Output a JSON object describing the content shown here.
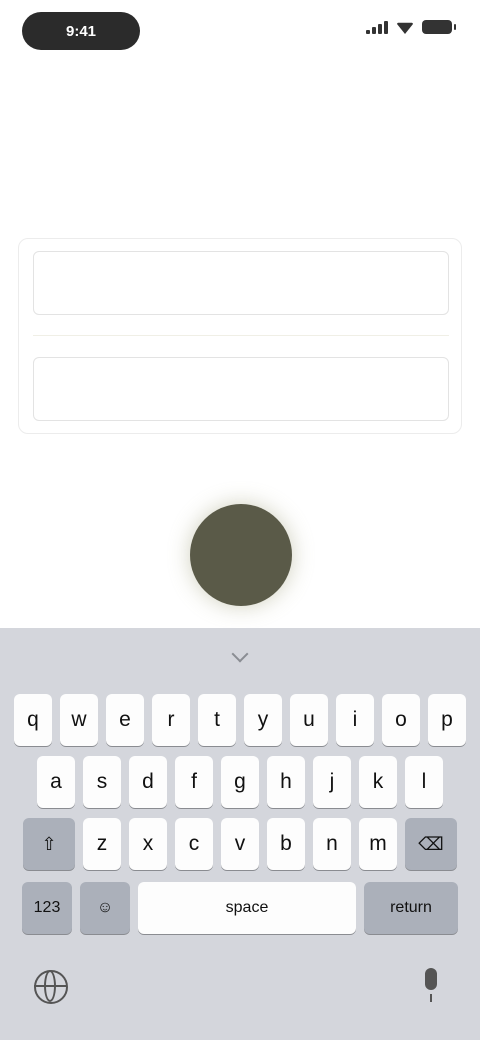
{
  "status_bar": {
    "time": "9:41"
  },
  "title": "",
  "form": {
    "field_1_placeholder": "",
    "field_2_placeholder": ""
  },
  "keyboard": {
    "row1": [
      "q",
      "w",
      "e",
      "r",
      "t",
      "y",
      "u",
      "i",
      "o",
      "p"
    ],
    "row2": [
      "a",
      "s",
      "d",
      "f",
      "g",
      "h",
      "j",
      "k",
      "l"
    ],
    "row3": [
      "z",
      "x",
      "c",
      "v",
      "b",
      "n",
      "m"
    ],
    "shift_icon": "shift-icon",
    "delete_icon": "delete-icon",
    "numbers_label": "123",
    "emoji_icon": "emoji-icon",
    "space_label": "space",
    "return_label": "return"
  },
  "colors": {
    "record_button": "#5a5a48",
    "keyboard_bg": "#d4d6dc"
  }
}
